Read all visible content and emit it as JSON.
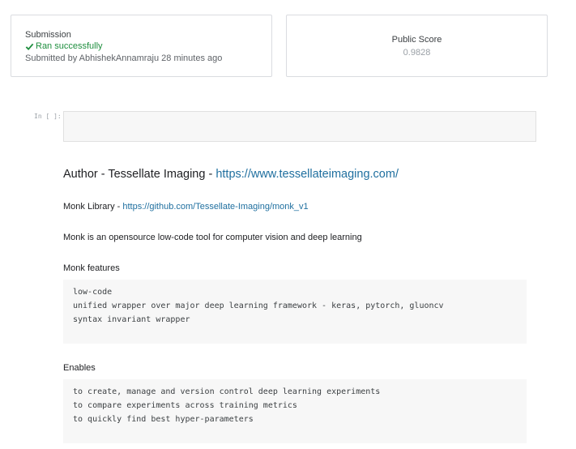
{
  "submission": {
    "label": "Submission",
    "status": "Ran successfully",
    "submitted_by": "Submitted by AbhishekAnnamraju 28 minutes ago"
  },
  "score": {
    "label": "Public Score",
    "value": "0.9828"
  },
  "cell": {
    "prompt": "In [ ]:"
  },
  "markdown": {
    "author_prefix": "Author - Tessellate Imaging - ",
    "author_link": "https://www.tessellateimaging.com/",
    "library_prefix": "Monk Library - ",
    "library_link": "https://github.com/Tessellate-Imaging/monk_v1",
    "description": "Monk is an opensource low-code tool for computer vision and deep learning",
    "features_heading": "Monk features",
    "features": [
      "low-code",
      "unified wrapper over major deep learning framework - keras, pytorch, gluoncv",
      "syntax invariant wrapper"
    ],
    "enables_heading": "Enables",
    "enables": [
      "to create, manage and version control deep learning experiments",
      "to compare experiments across training metrics",
      "to quickly find best hyper-parameters"
    ]
  },
  "colors": {
    "success": "#1e8e3e",
    "link": "#1f6f9f"
  }
}
